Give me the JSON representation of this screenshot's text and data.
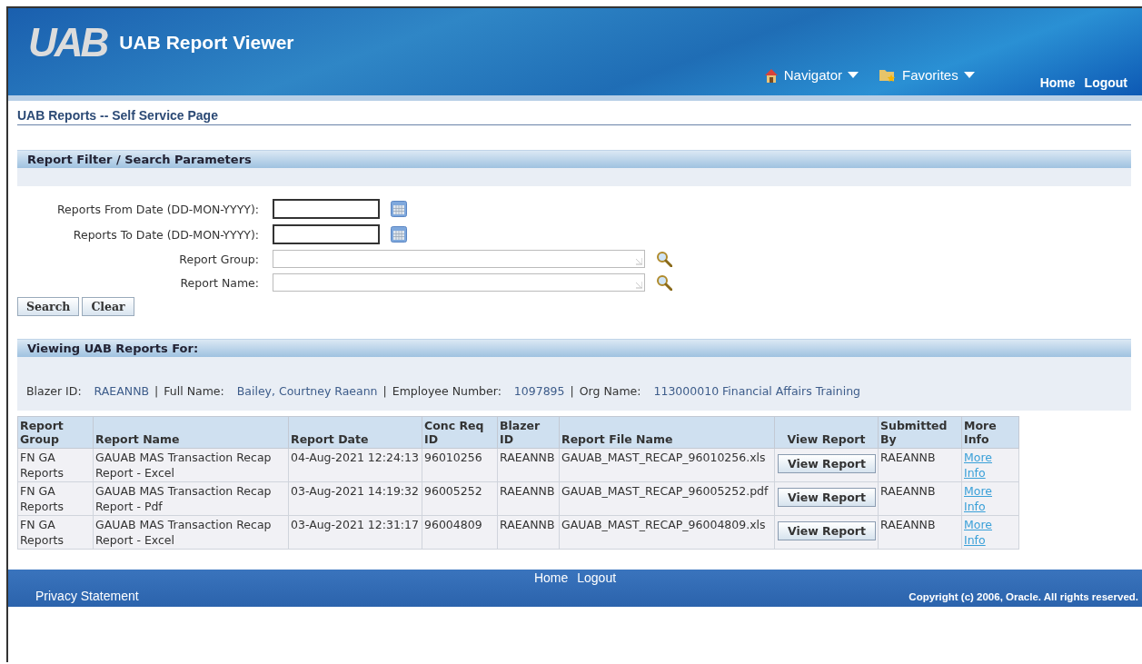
{
  "header": {
    "logo": "UAB",
    "title": "UAB Report Viewer",
    "menus": [
      "Navigator",
      "Favorites"
    ],
    "links": [
      "Home",
      "Logout"
    ]
  },
  "page_title": "UAB Reports -- Self Service Page",
  "filter": {
    "title": "Report Filter / Search Parameters",
    "fields": [
      {
        "kind": "date",
        "label": "Reports From Date (DD-MON-YYYY):"
      },
      {
        "kind": "date",
        "label": "Reports To Date (DD-MON-YYYY):"
      },
      {
        "kind": "lov",
        "label": "Report Group:"
      },
      {
        "kind": "lov",
        "label": "Report Name:"
      }
    ],
    "buttons": [
      "Search",
      "Clear"
    ]
  },
  "results": {
    "title": "Viewing UAB Reports For:",
    "separator": "|",
    "info": [
      {
        "label": "Blazer ID:",
        "value": "RAEANNB"
      },
      {
        "label": "Full Name:",
        "value": "Bailey, Courtney Raeann"
      },
      {
        "label": "Employee Number:",
        "value": "1097895"
      },
      {
        "label": "Org Name:",
        "value": "113000010 Financial Affairs Training"
      }
    ],
    "table": {
      "columns": [
        "Report Group",
        "Report Name",
        "Report Date",
        "Conc Req ID",
        "Blazer ID",
        "Report File Name",
        "View Report",
        "Submitted By",
        "More Info"
      ],
      "rows": [
        {
          "report_group": "FN GA Reports",
          "report_name": "GAUAB MAS Transaction Recap Report - Excel",
          "report_date": "04-Aug-2021 12:24:13",
          "conc_req_id": "96010256",
          "blazer_id": "RAEANNB",
          "file_name": "GAUAB_MAST_RECAP_96010256.xls",
          "view": "View Report",
          "submitted_by": "RAEANNB",
          "more_info": "More Info"
        },
        {
          "report_group": "FN GA Reports",
          "report_name": "GAUAB MAS Transaction Recap Report - Pdf",
          "report_date": "03-Aug-2021 14:19:32",
          "conc_req_id": "96005252",
          "blazer_id": "RAEANNB",
          "file_name": "GAUAB_MAST_RECAP_96005252.pdf",
          "view": "View Report",
          "submitted_by": "RAEANNB",
          "more_info": "More Info"
        },
        {
          "report_group": "FN GA Reports",
          "report_name": "GAUAB MAS Transaction Recap Report - Excel",
          "report_date": "03-Aug-2021 12:31:17",
          "conc_req_id": "96004809",
          "blazer_id": "RAEANNB",
          "file_name": "GAUAB_MAST_RECAP_96004809.xls",
          "view": "View Report",
          "submitted_by": "RAEANNB",
          "more_info": "More Info"
        }
      ]
    }
  },
  "footer": {
    "links": [
      "Home",
      "Logout"
    ],
    "privacy": "Privacy Statement",
    "copyright": "Copyright (c) 2006, Oracle. All rights reserved."
  }
}
